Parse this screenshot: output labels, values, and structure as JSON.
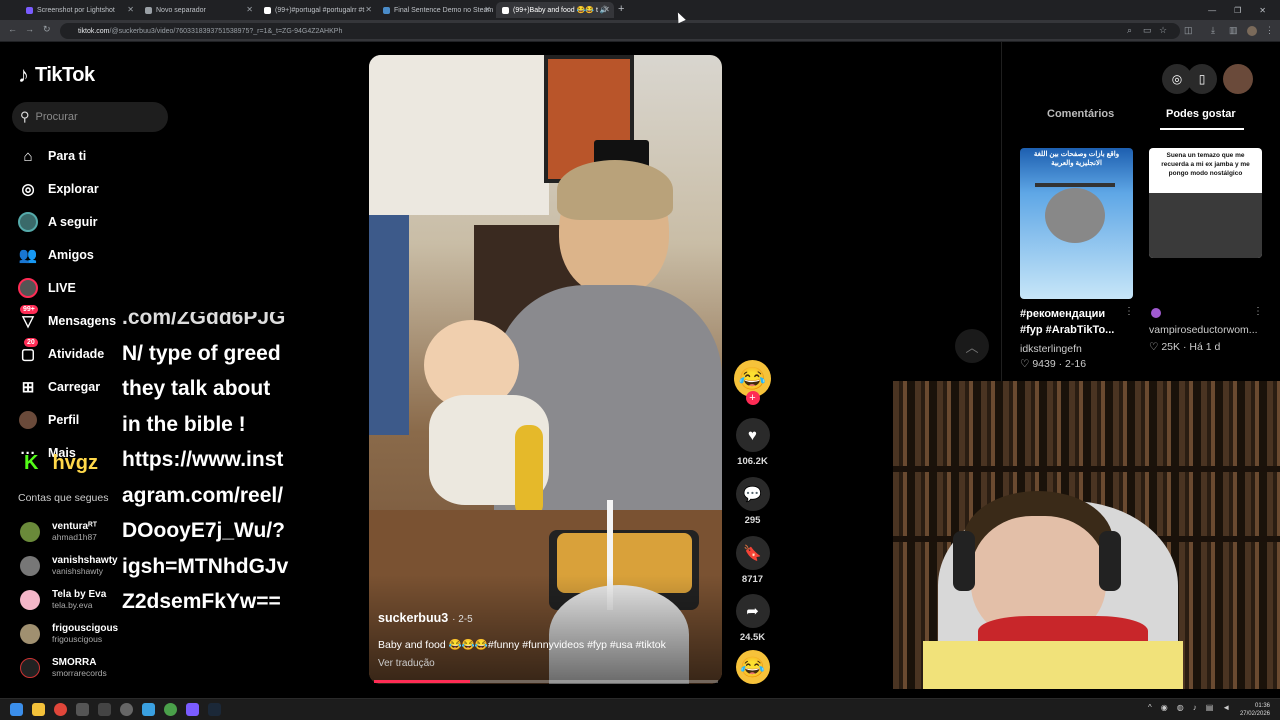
{
  "browser": {
    "tabs": [
      {
        "label": "Screenshot por Lightshot"
      },
      {
        "label": "Novo separador"
      },
      {
        "label": "(99+)#portugal #portugalrr #t"
      },
      {
        "label": "Final Sentence Demo no Steam"
      },
      {
        "label": "(99+)Baby and food 😂😂 t 🔊"
      }
    ],
    "url_host": "tiktok.com",
    "url_path": "/@suckerbuu3/video/7603318393751538975?_r=1&_t=ZG-94G4Z2AHKPh"
  },
  "sidebar": {
    "logo": "TikTok",
    "search_placeholder": "Procurar",
    "nav": [
      {
        "label": "Para ti",
        "icon": "home-icon"
      },
      {
        "label": "Explorar",
        "icon": "compass-icon"
      },
      {
        "label": "A seguir",
        "icon": "following-icon"
      },
      {
        "label": "Amigos",
        "icon": "friends-icon"
      },
      {
        "label": "LIVE",
        "icon": "live-icon"
      },
      {
        "label": "Mensagens",
        "icon": "messages-icon",
        "badge": "99+"
      },
      {
        "label": "Atividade",
        "icon": "activity-icon",
        "badge": "20"
      },
      {
        "label": "Carregar",
        "icon": "upload-icon"
      },
      {
        "label": "Perfil",
        "icon": "profile-icon"
      },
      {
        "label": "Mais",
        "icon": "more-icon"
      }
    ],
    "following_title": "Contas que segues",
    "accounts": [
      {
        "name": "venturaᴿᵀ",
        "handle": "ahmad1h87",
        "color": "#6a8a3a"
      },
      {
        "name": "vanishshawty",
        "handle": "vanishshawty",
        "color": "#777777"
      },
      {
        "name": "Tela by Eva",
        "handle": "tela.by.eva",
        "color": "#f4b6c8"
      },
      {
        "name": "frigouscigous",
        "handle": "frigouscigous",
        "color": "#a09070"
      },
      {
        "name": "SMORRA",
        "handle": "smorrarecords",
        "color": "#222222"
      }
    ]
  },
  "overlay": {
    "lines": [
      ".com/ZGdd6PJG",
      "N/ type of greed",
      "they talk about",
      "in the bible !",
      "https://www.inst",
      "agram.com/reel/",
      "DOooyE7j_Wu/?",
      "igsh=MTNhdGJv",
      "Z2dsemFkYw=="
    ],
    "kick_letter": "K",
    "kick_name": "hvgz"
  },
  "video": {
    "author": "suckerbuu3",
    "date": "· 2-5",
    "description": "Baby and food 😂😂😂#funny #funnyvideos #fyp #usa #tiktok",
    "translate": "Ver tradução",
    "progress": 0.28
  },
  "actions": {
    "likes": "106.2K",
    "comments": "295",
    "saves": "8717",
    "shares": "24.5K"
  },
  "right_panel": {
    "tabs": [
      "Comentários",
      "Podes gostar"
    ],
    "suggestions": [
      {
        "thumb_text": "واقع بازات وصفحات بين اللغة الانجليزية والعربية",
        "title": "#рекомендации #fyp #ArabTikTo...",
        "user": "idksterlingefn",
        "likes": "9439",
        "date": "2-16"
      },
      {
        "thumb_text": "Suena un temazo que me recuerda a mi ex jamba y me pongo modo nostálgico",
        "title": "",
        "user": "vampiroseductorwom...",
        "likes": "25K",
        "date": "Há 1 d"
      }
    ]
  },
  "taskbar": {
    "time": "01:36",
    "date": "27/02/2026"
  }
}
